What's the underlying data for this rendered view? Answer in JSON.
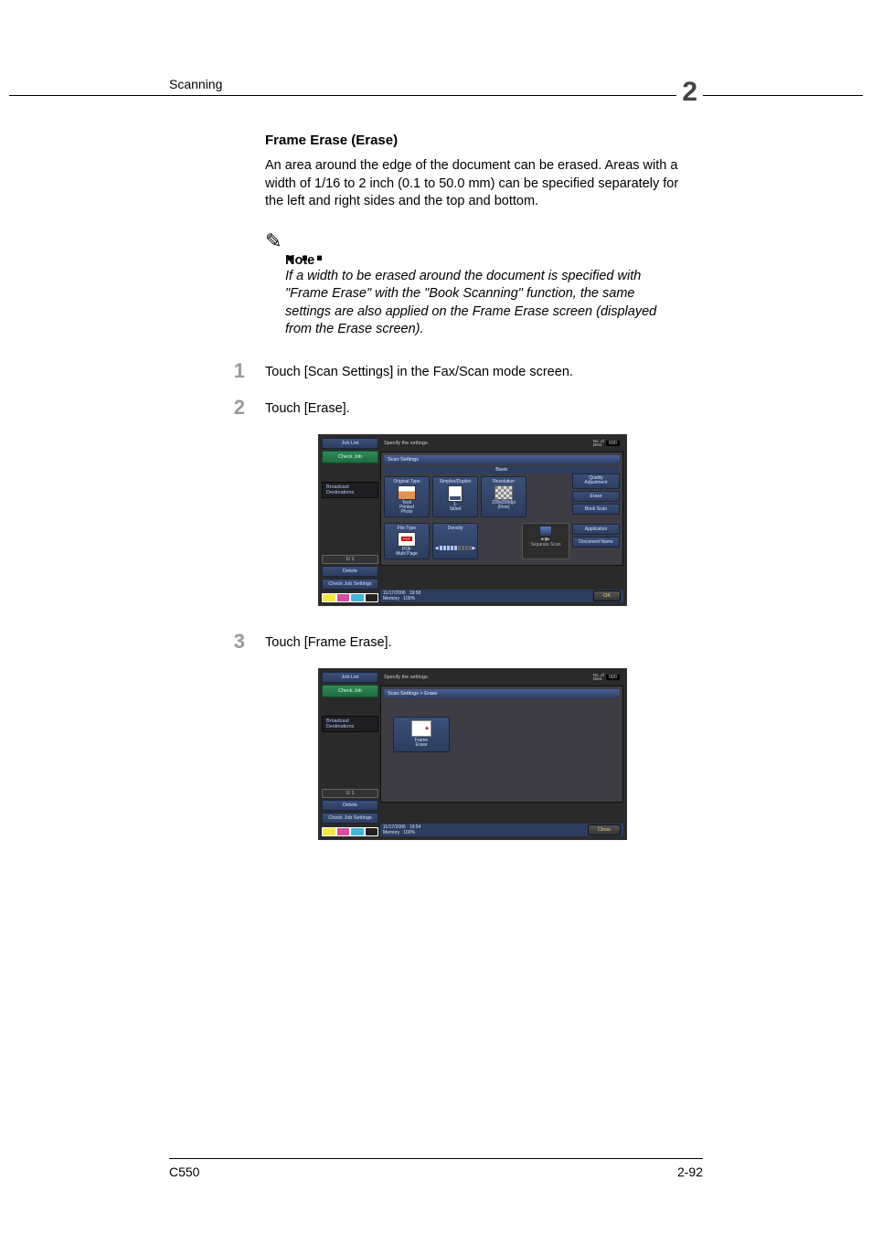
{
  "header": {
    "left": "Scanning",
    "chapter": "2"
  },
  "section": {
    "title": "Frame Erase (Erase)",
    "body": "An area around the edge of the document can be erased. Areas with a width of 1/16 to 2 inch (0.1 to 50.0 mm) can be specified separately for the left and right sides and the top and bottom."
  },
  "note": {
    "label": "Note",
    "text": "If a width to be erased around the document is specified with \"Frame Erase\" with the \"Book Scanning\" function, the same settings are also applied on the Frame Erase screen (displayed from the Erase screen)."
  },
  "steps": [
    {
      "num": "1",
      "text": "Touch [Scan Settings] in the Fax/Scan mode screen."
    },
    {
      "num": "2",
      "text": "Touch [Erase]."
    },
    {
      "num": "3",
      "text": "Touch [Frame Erase]."
    }
  ],
  "screenshot1": {
    "prompt": "Specify the settings.",
    "dest_label": "No. of\nDest.",
    "dest_count": "000",
    "left": {
      "job_list": "Job List",
      "check_job": "Check Job",
      "broadcast": "Broadcast\nDestinations",
      "page": "1/  1",
      "delete": "Delete",
      "check_settings": "Check Job\nSettings"
    },
    "panel_title": "Scan Settings",
    "tab": "Basic",
    "tiles_row1": [
      {
        "label": "Original Type",
        "sub": "Text/\nPrinted\nPhoto"
      },
      {
        "label": "Simplex/Duplex",
        "sub": "1-\nSided"
      },
      {
        "label": "Resolution",
        "sub": "200x200dpi\n(Fine)"
      }
    ],
    "tiles_row2": [
      {
        "label": "File Type",
        "sub": "PDF\nMulti Page"
      },
      {
        "label": "Density",
        "sub": ""
      }
    ],
    "separate_scan": "Separate Scan",
    "side": [
      "Quality\nAdjustment",
      "Erase",
      "Book Scan",
      "Application",
      "Document Name"
    ],
    "status": {
      "date": "11/17/2006",
      "time": "19:58",
      "memory_label": "Memory",
      "memory": "100%"
    },
    "ok": "OK",
    "color_keys": [
      "Y",
      "M",
      "C",
      "K"
    ]
  },
  "screenshot2": {
    "prompt": "Specify the settings.",
    "dest_label": "No. of\nDest.",
    "dest_count": "000",
    "left": {
      "job_list": "Job List",
      "check_job": "Check Job",
      "broadcast": "Broadcast\nDestinations",
      "page": "1/  1",
      "delete": "Delete",
      "check_settings": "Check Job\nSettings"
    },
    "breadcrumb": "Scan Settings > Erase",
    "frame_erase": "Frame\nErase",
    "status": {
      "date": "11/17/2006",
      "time": "19:54",
      "memory_label": "Memory",
      "memory": "100%"
    },
    "close": "Close",
    "color_keys": [
      "Y",
      "M",
      "C",
      "K"
    ]
  },
  "footer": {
    "model": "C550",
    "page": "2-92"
  }
}
